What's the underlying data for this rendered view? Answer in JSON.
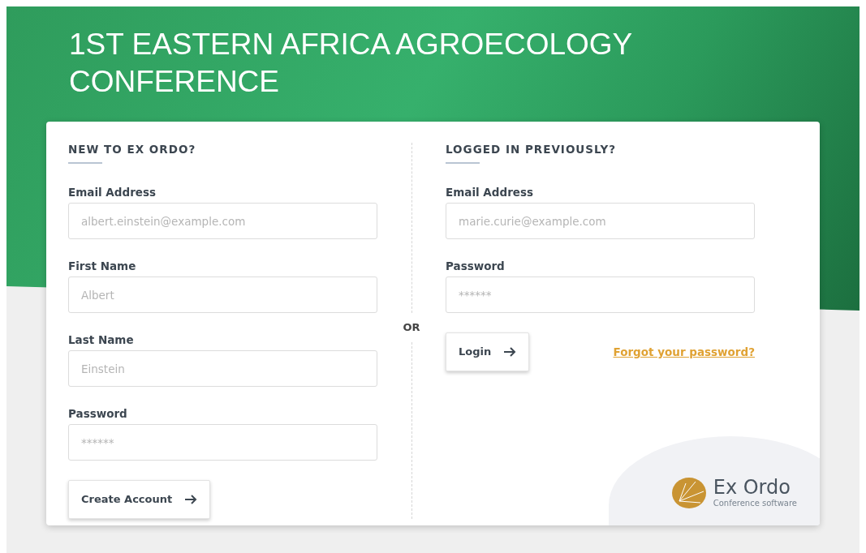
{
  "title": "1ST EASTERN AFRICA AGROECOLOGY CONFERENCE",
  "register": {
    "heading": "NEW TO EX ORDO?",
    "fields": [
      {
        "label": "Email Address",
        "placeholder": "albert.einstein@example.com"
      },
      {
        "label": "First Name",
        "placeholder": "Albert"
      },
      {
        "label": "Last Name",
        "placeholder": "Einstein"
      },
      {
        "label": "Password",
        "placeholder": "******"
      }
    ],
    "button": "Create Account"
  },
  "separator": "OR",
  "login": {
    "heading": "LOGGED IN PREVIOUSLY?",
    "fields": [
      {
        "label": "Email Address",
        "placeholder": "marie.curie@example.com"
      },
      {
        "label": "Password",
        "placeholder": "******"
      }
    ],
    "button": "Login",
    "link": "Forgot your password?"
  },
  "logo": {
    "name": "Ex Ordo",
    "tagline": "Conference software"
  }
}
